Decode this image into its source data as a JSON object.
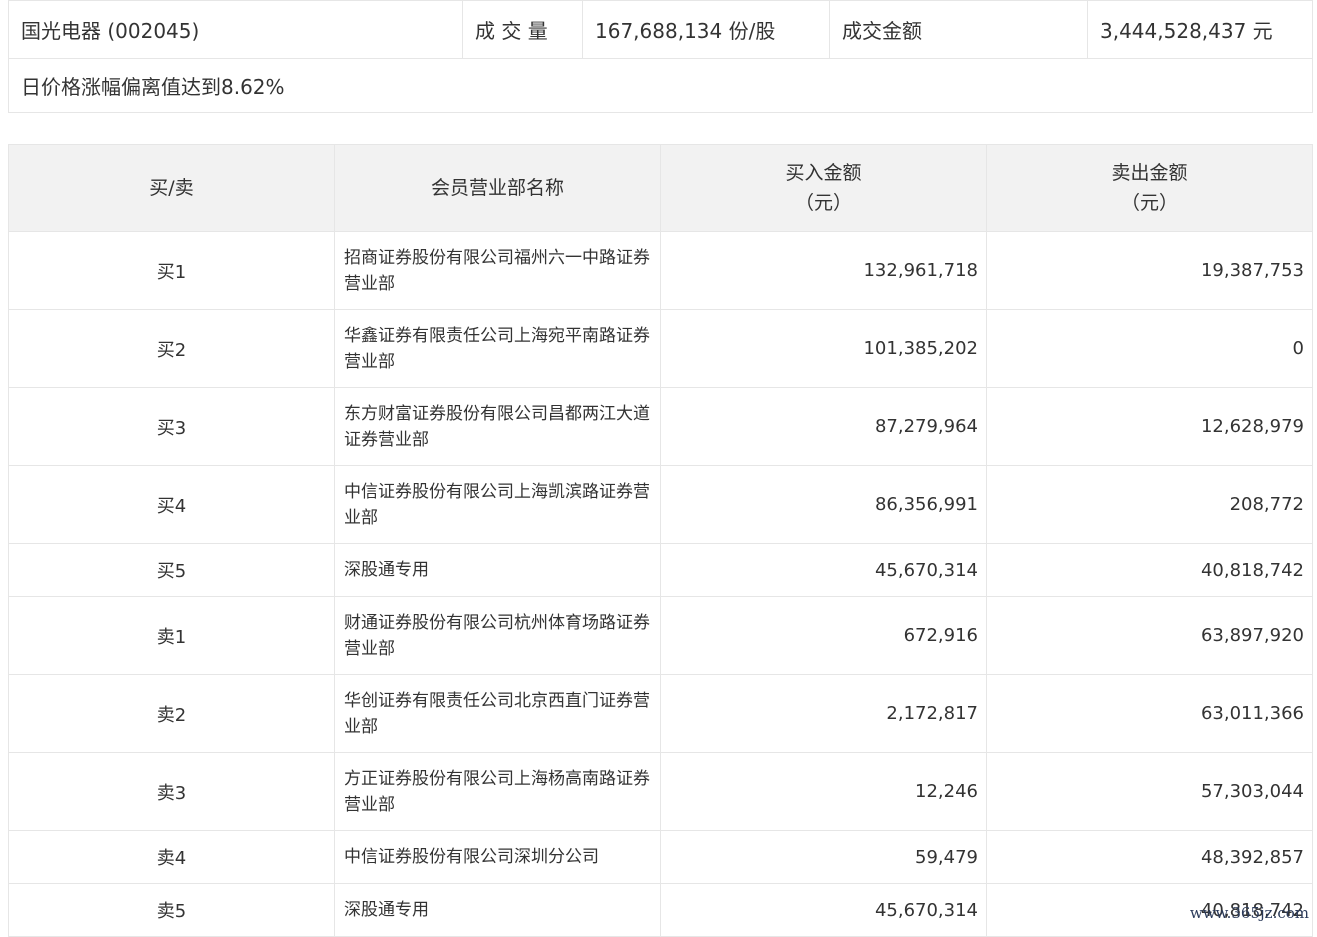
{
  "summary": {
    "stock": "国光电器 (002045)",
    "volume_label": "成 交 量",
    "volume_value": "167,688,134 份/股",
    "amount_label": "成交金额",
    "amount_value": "3,444,528,437 元",
    "reason": "日价格涨幅偏离值达到8.62%"
  },
  "table": {
    "headers": {
      "side": "买/卖",
      "member": "会员营业部名称",
      "buy_line1": "买入金额",
      "buy_line2": "（元）",
      "sell_line1": "卖出金额",
      "sell_line2": "（元）"
    },
    "rows": [
      {
        "side": "买1",
        "member": "招商证券股份有限公司福州六一中路证券营业部",
        "buy": "132,961,718",
        "sell": "19,387,753"
      },
      {
        "side": "买2",
        "member": "华鑫证券有限责任公司上海宛平南路证券营业部",
        "buy": "101,385,202",
        "sell": "0"
      },
      {
        "side": "买3",
        "member": "东方财富证券股份有限公司昌都两江大道证券营业部",
        "buy": "87,279,964",
        "sell": "12,628,979"
      },
      {
        "side": "买4",
        "member": "中信证券股份有限公司上海凯滨路证券营业部",
        "buy": "86,356,991",
        "sell": "208,772"
      },
      {
        "side": "买5",
        "member": "深股通专用",
        "buy": "45,670,314",
        "sell": "40,818,742"
      },
      {
        "side": "卖1",
        "member": "财通证券股份有限公司杭州体育场路证券营业部",
        "buy": "672,916",
        "sell": "63,897,920"
      },
      {
        "side": "卖2",
        "member": "华创证券有限责任公司北京西直门证券营业部",
        "buy": "2,172,817",
        "sell": "63,011,366"
      },
      {
        "side": "卖3",
        "member": "方正证券股份有限公司上海杨高南路证券营业部",
        "buy": "12,246",
        "sell": "57,303,044"
      },
      {
        "side": "卖4",
        "member": "中信证券股份有限公司深圳分公司",
        "buy": "59,479",
        "sell": "48,392,857"
      },
      {
        "side": "卖5",
        "member": "深股通专用",
        "buy": "45,670,314",
        "sell": "40,818,742"
      }
    ]
  },
  "watermark": "www.365jz.com"
}
